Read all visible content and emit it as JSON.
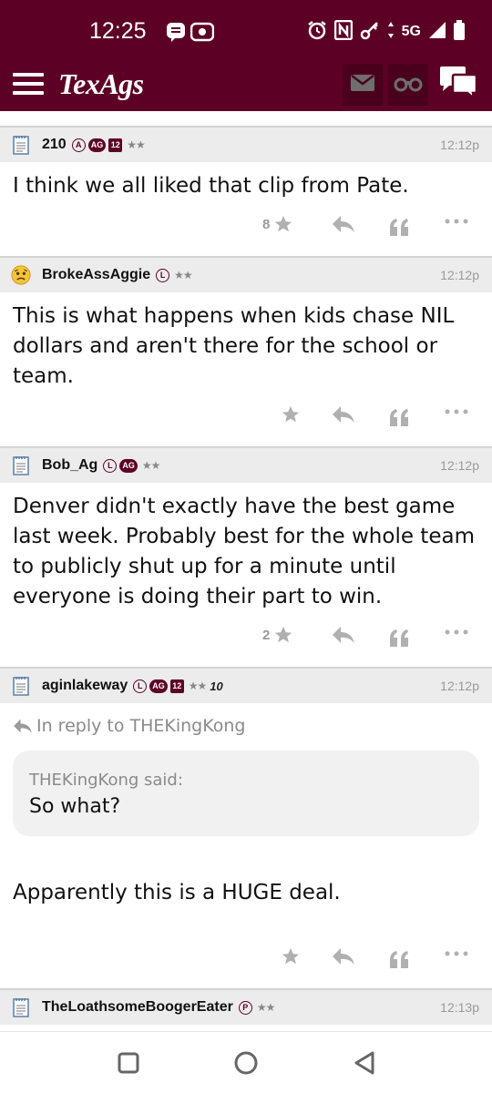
{
  "status_bar": {
    "time": "12:25",
    "network": "5G",
    "icons": [
      "message-icon",
      "record-icon",
      "alarm-icon",
      "nfc-icon",
      "key-icon",
      "data-arrows-icon",
      "signal-icon",
      "battery-icon"
    ]
  },
  "header": {
    "logo": "TexAgs",
    "icons": [
      "menu-icon",
      "mail-icon",
      "binoculars-icon",
      "chat-icon"
    ]
  },
  "colors": {
    "brand": "#5d0025",
    "header_bg": "#ececec",
    "muted": "#999999"
  },
  "posts": [
    {
      "username": "210",
      "avatar": "notepad-icon",
      "badges": [
        "A",
        "AG",
        "12",
        "★★"
      ],
      "time": "12:12p",
      "body": "I think we all liked that clip from Pate.",
      "star_count": "8"
    },
    {
      "username": "BrokeAssAggie",
      "avatar": "sad-face-icon",
      "badges": [
        "L",
        "★★"
      ],
      "time": "12:12p",
      "body": "This is what happens when kids chase NIL dollars and aren't there for the school or team.",
      "star_count": ""
    },
    {
      "username": "Bob_Ag",
      "avatar": "notepad-icon",
      "badges": [
        "L",
        "AG",
        "★★"
      ],
      "time": "12:12p",
      "body": "Denver didn't exactly have the best game last week. Probably best for the whole team to publicly shut up for a minute until everyone is doing their part to win.",
      "star_count": "2"
    },
    {
      "username": "aginlakeway",
      "avatar": "notepad-icon",
      "badges": [
        "L",
        "AG",
        "12",
        "★★",
        "10"
      ],
      "time": "12:12p",
      "reply_to": "In reply to THEKingKong",
      "quote_author": "THEKingKong said:",
      "quote_text": "So what?",
      "body": "Apparently this is a HUGE deal.",
      "star_count": ""
    },
    {
      "username": "TheLoathsomeBoogerEater",
      "avatar": "notepad-icon",
      "badges": [
        "P",
        "★★"
      ],
      "time": "12:13p"
    }
  ],
  "nav": {
    "icons": [
      "recents-icon",
      "home-icon",
      "back-icon"
    ]
  }
}
